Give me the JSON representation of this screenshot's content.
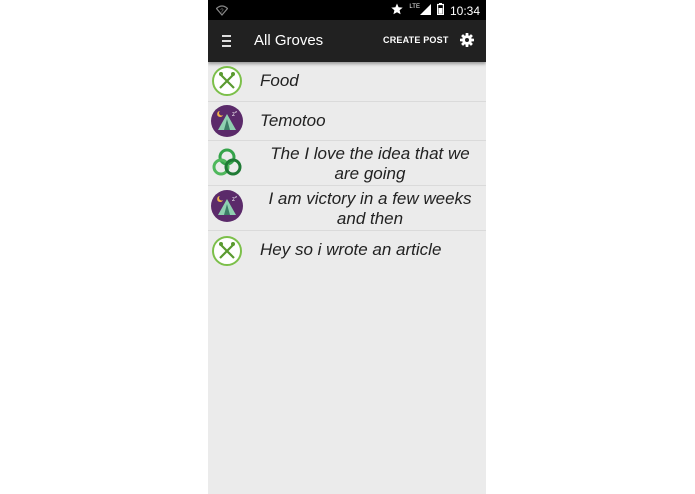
{
  "status_bar": {
    "time": "10:34",
    "network": "LTE",
    "icons": [
      "wifi-icon",
      "star-icon",
      "signal-icon",
      "battery-icon"
    ]
  },
  "app_bar": {
    "title": "All Groves",
    "create_post_label": "CREATE POST",
    "icons": [
      "menu-icon",
      "settings-gear-icon"
    ]
  },
  "groves": [
    {
      "title": "Food",
      "icon": "fork-knife-icon"
    },
    {
      "title": "Temotoo",
      "icon": "tent-night-icon"
    },
    {
      "title": "The I love the idea that we are going",
      "icon": "green-rings-icon"
    },
    {
      "title": "I am victory in a few weeks and then",
      "icon": "tent-night-icon"
    },
    {
      "title": "Hey so i wrote an article",
      "icon": "fork-knife-icon"
    }
  ],
  "colors": {
    "app_bar": "#212121",
    "list_background": "#ebebeb",
    "food_green": "#7cbf4a",
    "tent_purple": "#5b2a6a",
    "rings_green": "#35a34a"
  }
}
